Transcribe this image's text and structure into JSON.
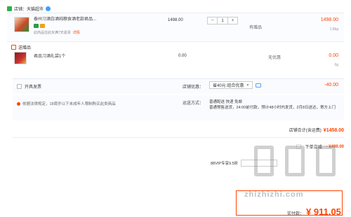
{
  "store": {
    "name": "店铺：天猫超市"
  },
  "product": {
    "title": "泰州习酒白酒纯粮食酒老款君品...",
    "notice": "此商品住此买满7天退货",
    "notice_link": "详情",
    "unit_price": "1498.00",
    "quantity": "1",
    "qty_minus": "−",
    "qty_plus": "+",
    "promo": "有赠品",
    "subtotal": "1498.00",
    "weight": "1.8kg"
  },
  "gift": {
    "header": "送赠品",
    "title": "君品习酒礼袋1个",
    "unit_price": "0.00",
    "promo": "无优惠",
    "subtotal": "0.00",
    "weight": "0g"
  },
  "invoice": {
    "label": "开具发票",
    "store_discount_label": "店铺优惠：",
    "discount_select": "省40元:组合优惠",
    "discount_amount": "-40.00"
  },
  "legal": {
    "notice": "依据法律规定，18周岁以下未成年人限制购买此类商品"
  },
  "shipping": {
    "label": "运送方式：",
    "line1": "普通配送 快递 免邮",
    "line2": "普通预售送货，24:00前付款，预计48小时内发货，2月8日送达，寄方上门"
  },
  "store_total": {
    "label": "店铺合计(含运费)",
    "amount": "¥1458.00"
  },
  "discount": {
    "label": "下单立减",
    "amount": "- ¥499.00"
  },
  "vip": {
    "label": "88VIP专享9.5折"
  },
  "pay": {
    "label": "实付款：",
    "amount": "¥ 911.05"
  },
  "watermark": {
    "text": "zhizhizhi.com"
  }
}
